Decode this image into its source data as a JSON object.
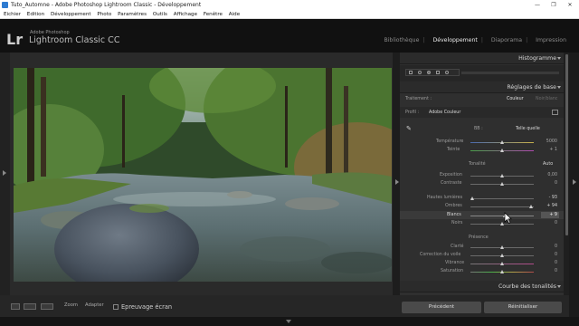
{
  "window": {
    "title": "Tuto_Automne - Adobe Photoshop Lightroom Classic - Développement",
    "controls": [
      "—",
      "❐",
      "✕"
    ]
  },
  "menu": [
    "Eichier",
    "Edition",
    "Développement",
    "Photo",
    "Paramètres",
    "Outils",
    "Affichage",
    "Fenêtre",
    "Aide"
  ],
  "brand": {
    "logo": "Lr",
    "top": "Adobe Photoshop",
    "name": "Lightroom Classic CC"
  },
  "modules": [
    "Bibliothèque",
    "Développement",
    "Diaporama",
    "Impression"
  ],
  "toolbar": {
    "zoom": "Zoom",
    "adapter": "Adapter",
    "softproof": "Epreuvage écran"
  },
  "panel": {
    "histogram": "Histogramme",
    "basic": "Réglages de base",
    "treatment_label": "Traitement :",
    "treatment_color": "Couleur",
    "treatment_bw": "Noir/blanc",
    "profile_label": "Profil :",
    "profile_value": "Adobe Couleur",
    "wb_label": "BB :",
    "wb_value": "Telle quelle",
    "temp_label": "Température",
    "temp_value": "5000",
    "tint_label": "Teinte",
    "tint_value": "+ 1",
    "tone_label": "Tonalité",
    "tone_auto": "Auto",
    "exposure_label": "Exposition",
    "exposure_value": "0,00",
    "contrast_label": "Contraste",
    "contrast_value": "0",
    "highlights_label": "Hautes lumières",
    "highlights_value": "- 93",
    "shadows_label": "Ombres",
    "shadows_value": "+ 94",
    "whites_label": "Blancs",
    "whites_value": "+ 9",
    "blacks_label": "Noirs",
    "blacks_value": "0",
    "presence_label": "Présence",
    "clarity_label": "Clarté",
    "clarity_value": "0",
    "dehaze_label": "Correction du voile",
    "dehaze_value": "0",
    "vibrance_label": "Vibrance",
    "vibrance_value": "0",
    "saturation_label": "Saturation",
    "saturation_value": "0",
    "tone_curve": "Courbe des tonalités",
    "prev_button": "Précédent",
    "reset_button": "Réinitialiser"
  },
  "levels": {
    "temp": 0.5,
    "tint": 0.5,
    "exposure": 0.5,
    "contrast": 0.5,
    "highlights": 0.03,
    "shadows": 0.97,
    "whites": 0.55,
    "blacks": 0.5,
    "clarity": 0.5,
    "dehaze": 0.5,
    "vibrance": 0.5,
    "saturation": 0.5
  },
  "colors": {
    "accent": "#eaeaea",
    "panel_bg": "#2f2f2f",
    "topbar_bg": "#111111"
  }
}
